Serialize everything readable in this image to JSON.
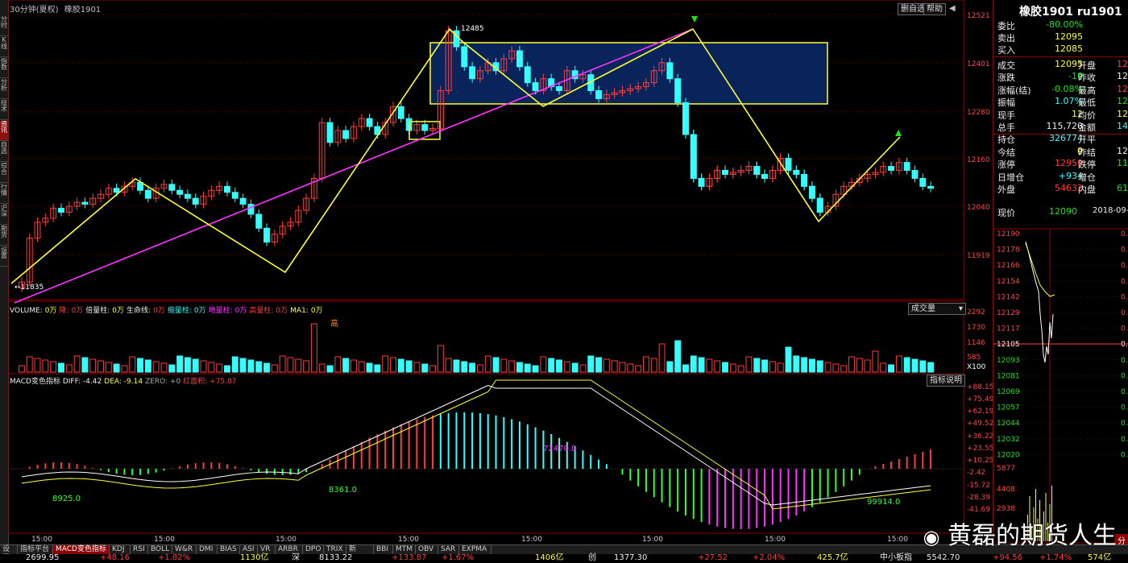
{
  "window": {
    "period_label": "30分钟(夏权)",
    "symbol_label": "橡胶1901",
    "btn_self": "删自选",
    "btn_help": "帮助"
  },
  "leftbar_tabs": [
    "分时",
    "K线",
    "指数",
    "分析",
    "技术",
    "资讯",
    "自选",
    "综合",
    "行情",
    "沪深",
    "期货",
    "设置"
  ],
  "price_axis": [
    "12521",
    "12401",
    "12280",
    "12160",
    "12040",
    "11919"
  ],
  "chart_labels": {
    "high": "12485",
    "low": "11835"
  },
  "volume": {
    "legend": [
      {
        "t": "VOLUME:",
        "c": "white"
      },
      {
        "t": "0万",
        "c": "yellow"
      },
      {
        "t": "降:",
        "c": "red"
      },
      {
        "t": "0万",
        "c": "red"
      },
      {
        "t": "倍量柱:",
        "c": "white"
      },
      {
        "t": "0万",
        "c": "yellow"
      },
      {
        "t": "生命线:",
        "c": "white"
      },
      {
        "t": "0万",
        "c": "red"
      },
      {
        "t": "缩量柱:",
        "c": "cyan"
      },
      {
        "t": "0万",
        "c": "cyan"
      },
      {
        "t": "地量柱:",
        "c": "magenta"
      },
      {
        "t": "0万",
        "c": "magenta"
      },
      {
        "t": "高量柱:",
        "c": "red"
      },
      {
        "t": "0万",
        "c": "red"
      },
      {
        "t": "MA1:",
        "c": "yellow"
      },
      {
        "t": "0万",
        "c": "yellow"
      }
    ],
    "dropdown": "成交量",
    "axis": [
      "2292",
      "1730",
      "1146",
      "585",
      "X100"
    ],
    "high_mark": "高"
  },
  "macd": {
    "legend": [
      {
        "t": "MACD变色指标 DIFF: -4.42",
        "c": "white"
      },
      {
        "t": "DEA: -9.14",
        "c": "yellow"
      },
      {
        "t": "ZERO: +0",
        "c": "grey"
      },
      {
        "t": "红面积: +75.87",
        "c": "red"
      }
    ],
    "help_btn": "指标说明",
    "axis": [
      "+88.15",
      "+75.49",
      "+62.19",
      "+49.52",
      "+36.22",
      "+23.55",
      "+10.25",
      "-2.42",
      "-15.72",
      "-28.39",
      "-41.69"
    ],
    "areas": [
      "8925.0",
      "8361.0",
      "72470.0",
      "99914.0"
    ]
  },
  "time_axis": [
    "15:00",
    "15:00",
    "15:00",
    "15:00",
    "15:00",
    "15:00",
    "15:00",
    "15:00"
  ],
  "quote": {
    "title": "橡胶1901 ru1901",
    "rows": [
      {
        "a": "委比",
        "b": "-80.00%",
        "bc": "green",
        "c": "",
        "d": "",
        "dc": ""
      },
      {
        "a": "卖出",
        "b": "12095",
        "bc": "yellow",
        "c": "",
        "d": "",
        "dc": ""
      },
      {
        "a": "买入",
        "b": "12085",
        "bc": "yellow",
        "c": "",
        "d": "",
        "dc": ""
      },
      {
        "a": "成交",
        "b": "12095",
        "bc": "yellow",
        "c": "开盘",
        "d": "12",
        "dc": "red"
      },
      {
        "a": "涨跌",
        "b": "-10",
        "bc": "green",
        "c": "昨收",
        "d": "12",
        "dc": "white"
      },
      {
        "a": "涨幅(结)",
        "b": "-0.08%",
        "bc": "green",
        "c": "最高",
        "d": "12",
        "dc": "red"
      },
      {
        "a": "振幅",
        "b": "1.07%",
        "bc": "cyan",
        "c": "最低",
        "d": "12",
        "dc": "green"
      },
      {
        "a": "现手",
        "b": "12",
        "bc": "yellow",
        "c": "均价",
        "d": "12",
        "dc": "yellow"
      },
      {
        "a": "总手",
        "b": "115,720",
        "bc": "white",
        "c": "金额",
        "d": "140.",
        "dc": "cyan"
      },
      {
        "a": "持仓",
        "b": "326774",
        "bc": "cyan",
        "c": "开平",
        "d": "",
        "dc": ""
      },
      {
        "a": "今结",
        "b": "0",
        "bc": "yellow",
        "c": "昨结",
        "d": "12",
        "dc": "white"
      },
      {
        "a": "涨停",
        "b": "12950",
        "bc": "red",
        "c": "跌停",
        "d": "11",
        "dc": "green"
      },
      {
        "a": "日增仓",
        "b": "+934",
        "bc": "cyan",
        "c": "增仓",
        "d": "",
        "dc": ""
      },
      {
        "a": "外盘",
        "b": "54632",
        "bc": "red",
        "c": "内盘",
        "d": "61",
        "dc": "green"
      }
    ],
    "now_label": "现价",
    "now_value": "12090",
    "now_date": "2018-09-1",
    "mini_axis_left": [
      "12190",
      "12178",
      "12166",
      "12154",
      "12142",
      "12129",
      "12117",
      "12105",
      "12093",
      "12081",
      "12069",
      "12057",
      "12044",
      "12032",
      "12020"
    ],
    "mini_axis_right": [
      "0.7",
      "0.6",
      "0.5",
      "0.4",
      "0.3",
      "0.2",
      "0.1",
      "0.0",
      "0.1",
      "0.2",
      "0.3",
      "0.4",
      "0.5",
      "0.6",
      "0.7"
    ],
    "mini_vol_axis": [
      "5877",
      "4408",
      "2938"
    ],
    "bottom_tab": "分"
  },
  "bottom_tabs": [
    "设置",
    "指标平台",
    "MACD变色指标",
    "KDJ",
    "RSI",
    "BOLL",
    "W&R",
    "DMI",
    "BIAS",
    "ASI",
    "VR",
    "ARBR",
    "DPO",
    "TRIX",
    "新DMA",
    "BBI",
    "MTM",
    "OBV",
    "SAR",
    "EXPMA"
  ],
  "index_bar": [
    {
      "t": "2699.95",
      "c": "white"
    },
    {
      "t": "+48.16",
      "c": "red"
    },
    {
      "t": "+1.82%",
      "c": "red"
    },
    {
      "t": "1130亿",
      "c": "yellow"
    },
    {
      "t": "深",
      "c": "white"
    },
    {
      "t": "8133.22",
      "c": "white"
    },
    {
      "t": "+133.87",
      "c": "red"
    },
    {
      "t": "+1.67%",
      "c": "red"
    },
    {
      "t": "1406亿",
      "c": "yellow"
    },
    {
      "t": "创",
      "c": "white"
    },
    {
      "t": "1377.30",
      "c": "white"
    },
    {
      "t": "+27.52",
      "c": "red"
    },
    {
      "t": "+2.04%",
      "c": "red"
    },
    {
      "t": "425.7亿",
      "c": "yellow"
    },
    {
      "t": "中小板指",
      "c": "white"
    },
    {
      "t": "5542.70",
      "c": "white"
    },
    {
      "t": "+94.56",
      "c": "red"
    },
    {
      "t": "+1.74%",
      "c": "red"
    },
    {
      "t": "574亿",
      "c": "yellow"
    }
  ],
  "watermark": "黄磊的期货人生",
  "colors": {
    "up": "#ff3b3b",
    "down": "#33ffff",
    "ma": "#ff33ff",
    "trend": "#ffff33",
    "macd_neg": "#33ff33",
    "macd_neg2": "#ff33ff",
    "grid": "#8b0000"
  }
}
